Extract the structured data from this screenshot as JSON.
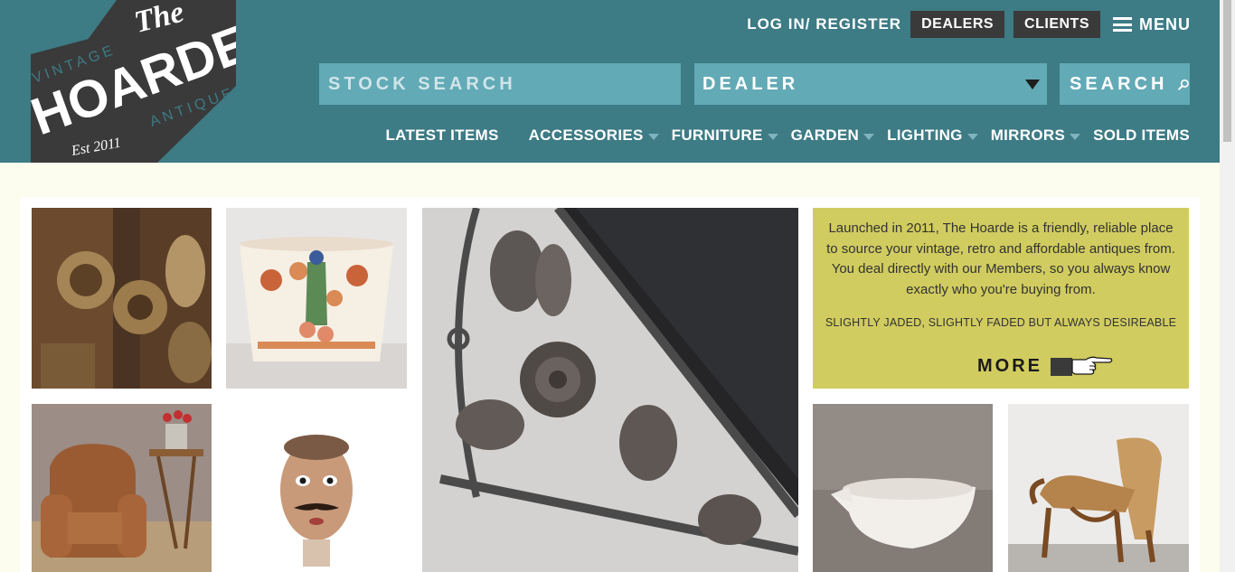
{
  "logo": {
    "line1": "The",
    "line2": "HOARDE",
    "left_word": "VINTAGE",
    "right_word": "ANTIQUE",
    "est": "Est 2011"
  },
  "toplinks": {
    "login": "LOG IN/ REGISTER",
    "dealers": "DEALERS",
    "clients": "CLIENTS",
    "menu": "MENU"
  },
  "search": {
    "stock_placeholder": "STOCK SEARCH",
    "dealer_selected": "DEALER",
    "button": "SEARCH"
  },
  "nav": {
    "items": [
      {
        "label": "LATEST ITEMS",
        "dropdown": false
      },
      {
        "label": "ACCESSORIES",
        "dropdown": true
      },
      {
        "label": "FURNITURE",
        "dropdown": true
      },
      {
        "label": "GARDEN",
        "dropdown": true
      },
      {
        "label": "LIGHTING",
        "dropdown": true
      },
      {
        "label": "MIRRORS",
        "dropdown": true
      },
      {
        "label": "SOLD ITEMS",
        "dropdown": false
      }
    ]
  },
  "info": {
    "text": "Launched in 2011, The Hoarde is a friendly, reliable place to source your vintage, retro and affordable antiques from.  You deal directly with our Members, so you always know exactly who you're buying from.",
    "tagline": "SLIGHTLY JADED, SLIGHTLY FADED BUT ALWAYS DESIREABLE",
    "more": "MORE"
  },
  "colors": {
    "header": "#3d7b85",
    "search_field": "#62aab6",
    "dark_button": "#3a3a3a",
    "info_card": "#d1cc60",
    "page_bg": "#fdfdef"
  },
  "icons": [
    "hamburger-icon",
    "dropdown-caret-icon",
    "search-icon",
    "pointing-hand-icon"
  ]
}
